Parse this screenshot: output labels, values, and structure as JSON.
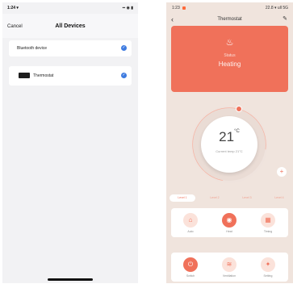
{
  "left_screen": {
    "status": {
      "time": "1:24 ▾",
      "icons": "▪▪ ◉ ▮"
    },
    "nav": {
      "cancel_label": "Cancel",
      "title": "All Devices"
    },
    "rows": [
      {
        "label": "Bluetooth device",
        "checked": true
      },
      {
        "label": "Thermostat",
        "checked": true
      }
    ]
  },
  "right_screen": {
    "status": {
      "time": "1:23",
      "icons": "22.8 ▾ ull 5G"
    },
    "nav": {
      "back_label": "‹",
      "title": "Thermostat",
      "edit_label": "✎"
    },
    "status_card": {
      "icon": "♨",
      "subtitle": "Status",
      "mode": "Heating"
    },
    "dial": {
      "temperature": "21",
      "unit": "°C",
      "current": "Current temp 21°C"
    },
    "tabs": [
      "Level 1",
      "Level 2",
      "Level 3",
      "Level 4"
    ],
    "modes": [
      {
        "label": "Auto",
        "icon": "⌂",
        "active": false
      },
      {
        "label": "Heat",
        "icon": "◉",
        "active": true
      },
      {
        "label": "Timing",
        "icon": "▦",
        "active": false
      }
    ],
    "bottom": [
      {
        "label": "Switch",
        "icon": "⏻",
        "active": true
      },
      {
        "label": "Ventilation",
        "icon": "≋",
        "active": false
      },
      {
        "label": "Setting",
        "icon": "✦",
        "active": false
      }
    ],
    "accent_color": "#f0715a"
  }
}
